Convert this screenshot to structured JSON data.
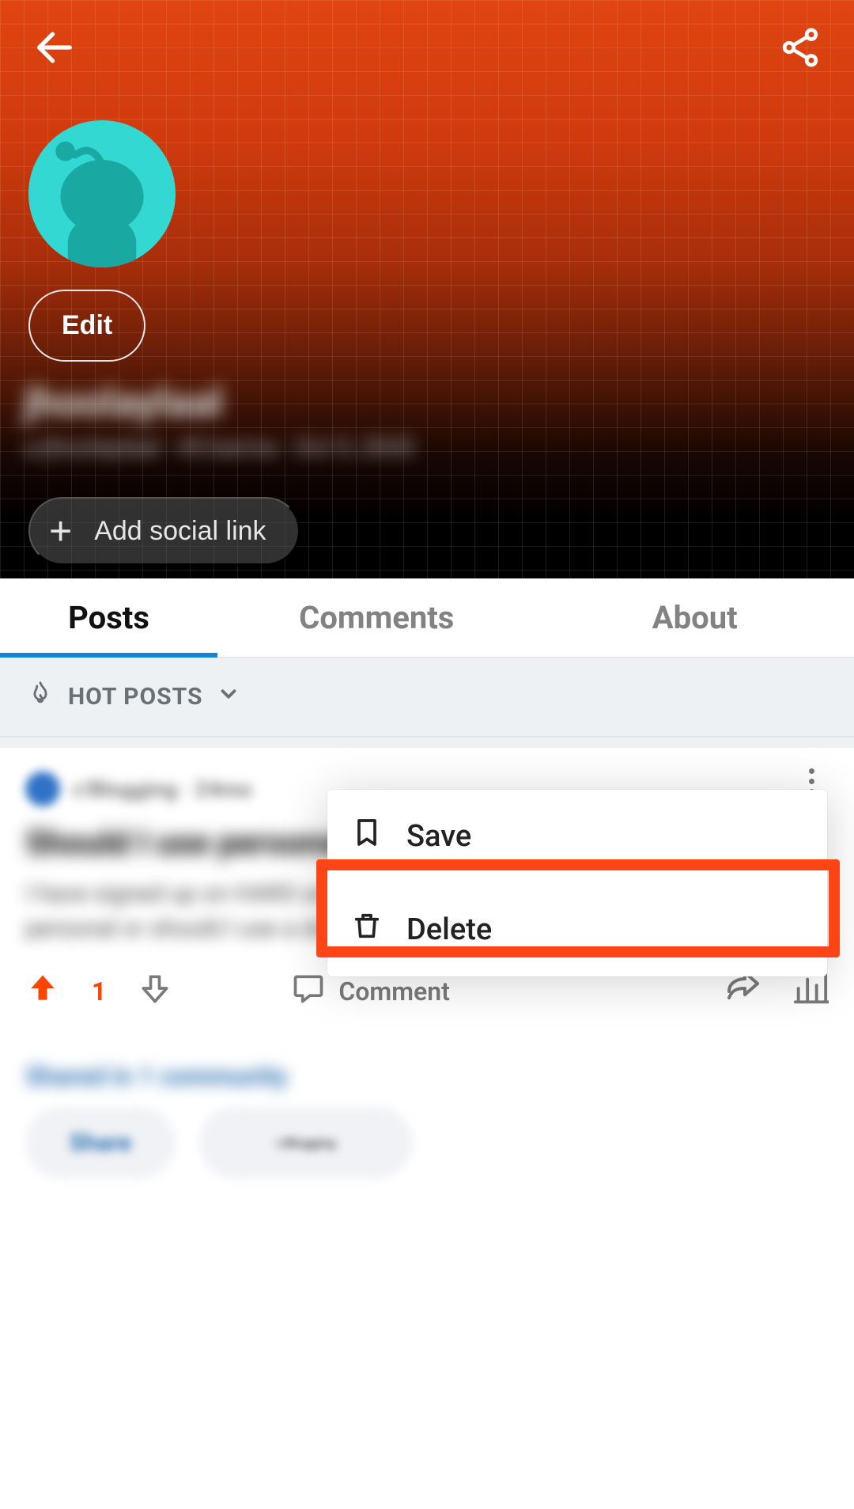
{
  "header": {
    "edit_label": "Edit",
    "add_social_label": "Add social link",
    "profile_name": "jhoolaylaal",
    "profile_meta": "u/jhoolaylaal · 45 karma · Oct 9, 2020"
  },
  "tabs": [
    {
      "label": "Posts",
      "active": true
    },
    {
      "label": "Comments",
      "active": false
    },
    {
      "label": "About",
      "active": false
    }
  ],
  "sort": {
    "label": "HOT POSTS"
  },
  "post": {
    "subreddit_meta": "r/Blogging · 24mo",
    "title": "Should I use personal",
    "body": "I have signed up on HARO and felt question. Should I use my personal or should I use a domain email to",
    "vote_count": "1",
    "comment_label": "Comment",
    "shared_label": "Shared in 1 community",
    "chip_share": "Share",
    "chip_sub": "r/Blogging"
  },
  "context_menu": {
    "save_label": "Save",
    "delete_label": "Delete"
  }
}
